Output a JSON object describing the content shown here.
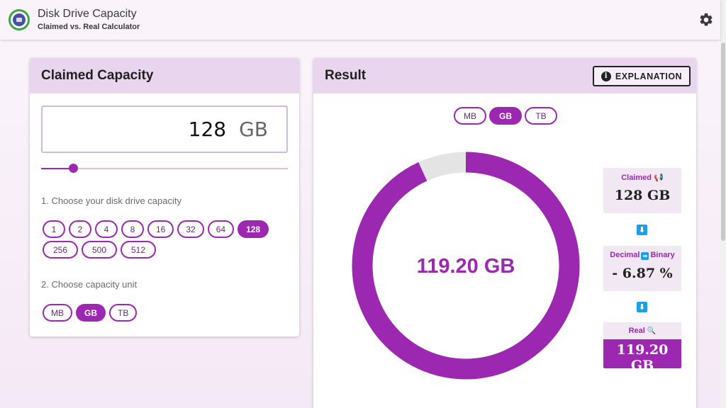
{
  "app": {
    "title": "Disk Drive Capacity",
    "subtitle": "Claimed vs. Real Calculator"
  },
  "claimed": {
    "header": "Claimed Capacity",
    "input_value": "128",
    "input_unit": "GB",
    "slider_fraction": 0.128,
    "step1_label": "1. Choose your disk drive capacity",
    "capacities": [
      "1",
      "2",
      "4",
      "8",
      "16",
      "32",
      "64",
      "128",
      "256",
      "500",
      "512"
    ],
    "selected_capacity": "128",
    "step2_label": "2. Choose capacity unit",
    "units": [
      "MB",
      "GB",
      "TB"
    ],
    "selected_unit": "GB"
  },
  "result": {
    "header": "Result",
    "explanation_label": "EXPLANATION",
    "info_icon_glyph": "i",
    "units": [
      "MB",
      "GB",
      "TB"
    ],
    "selected_unit": "GB",
    "donut_value_label": "119.20 GB",
    "real_fraction": 0.9313,
    "claimed_label": "Claimed",
    "claimed_value": "128 GB",
    "decimal_label": "Decimal",
    "binary_label": "Binary",
    "diff_value": "- 6.87 %",
    "real_label": "Real",
    "real_value": "119.20 GB"
  },
  "colors": {
    "accent": "#9c27b0",
    "remainder": "#e4e4e4",
    "header_bg": "#ead5ee",
    "arrow_blue": "#1e9ee3"
  },
  "icons": {
    "logo": "disk-drive-logo-icon",
    "settings": "gear-icon",
    "info": "info-icon",
    "claimed_emoji": "megaphone-icon",
    "real_emoji": "magnifier-icon",
    "arrow": "arrow-down-icon"
  }
}
